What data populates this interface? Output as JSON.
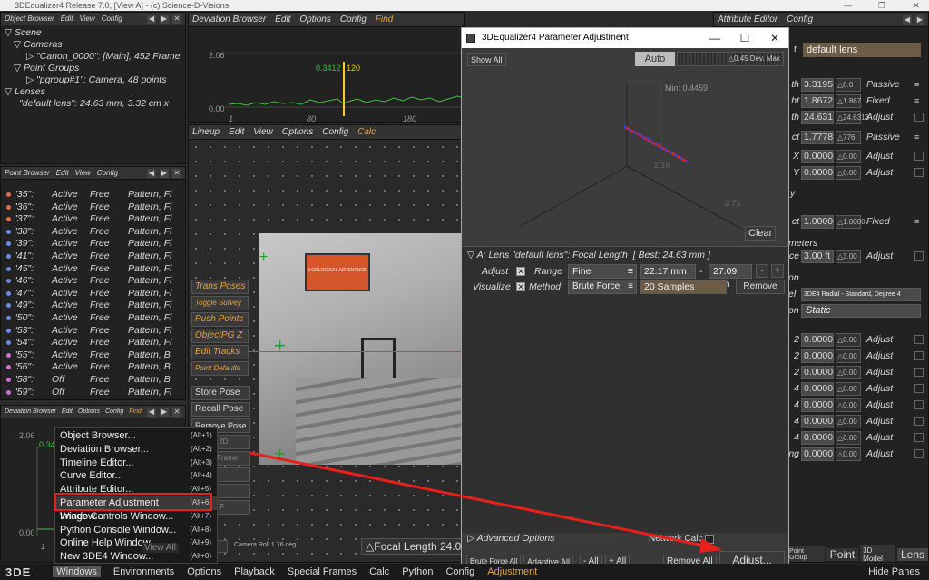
{
  "window": {
    "title": "3DEqualizer4 Release 7.0, [View A] - (c) Science-D-Visions"
  },
  "object_browser": {
    "menu": [
      "Object Browser",
      "Edit",
      "View",
      "Config"
    ],
    "tree": [
      {
        "label": "Scene",
        "level": 0
      },
      {
        "label": "Cameras",
        "level": 1
      },
      {
        "label": "\"Canon_0000\": [Main], 452 Frame",
        "level": 2,
        "highlight": true
      },
      {
        "label": "Point Groups",
        "level": 1
      },
      {
        "label": "\"pgroup#1\": Camera, 48 points",
        "level": 2,
        "highlight": true
      },
      {
        "label": "Lenses",
        "level": 0
      },
      {
        "label": "\"default lens\": 24.63 mm, 3.32 cm x",
        "level": 2
      }
    ]
  },
  "deviation_browser": {
    "menu": [
      "Deviation Browser",
      "Edit",
      "Options",
      "Config",
      "Find"
    ],
    "y_max": "2.06",
    "y_min": "0.00",
    "marker_value": "0.3412",
    "marker_frame": "120",
    "x_ticks": [
      "1",
      "80",
      "180"
    ]
  },
  "point_browser": {
    "menu": [
      "Point Browser",
      "Edit",
      "View",
      "Config"
    ],
    "rows": [
      {
        "name": "\"35\":",
        "status": "Active",
        "mode": "Free",
        "type": "Pattern, Fi",
        "color": "#e06c4c"
      },
      {
        "name": "\"36\":",
        "status": "Active",
        "mode": "Free",
        "type": "Pattern, Fi",
        "color": "#e06c4c"
      },
      {
        "name": "\"37\":",
        "status": "Active",
        "mode": "Free",
        "type": "Pattern, Fi",
        "color": "#e06c4c"
      },
      {
        "name": "\"38\":",
        "status": "Active",
        "mode": "Free",
        "type": "Pattern, Fi",
        "color": "#6c8ce0"
      },
      {
        "name": "\"39\":",
        "status": "Active",
        "mode": "Free",
        "type": "Pattern, Fi",
        "color": "#6c8ce0"
      },
      {
        "name": "\"41\":",
        "status": "Active",
        "mode": "Free",
        "type": "Pattern, Fi",
        "color": "#6c8ce0"
      },
      {
        "name": "\"45\":",
        "status": "Active",
        "mode": "Free",
        "type": "Pattern, Fi",
        "color": "#6c8ce0"
      },
      {
        "name": "\"46\":",
        "status": "Active",
        "mode": "Free",
        "type": "Pattern, Fi",
        "color": "#6c8ce0"
      },
      {
        "name": "\"47\":",
        "status": "Active",
        "mode": "Free",
        "type": "Pattern, Fi",
        "color": "#6c8ce0"
      },
      {
        "name": "\"49\":",
        "status": "Active",
        "mode": "Free",
        "type": "Pattern, Fi",
        "color": "#6c8ce0"
      },
      {
        "name": "\"50\":",
        "status": "Active",
        "mode": "Free",
        "type": "Pattern, Fi",
        "color": "#6c8ce0"
      },
      {
        "name": "\"53\":",
        "status": "Active",
        "mode": "Free",
        "type": "Pattern, Fi",
        "color": "#6c8ce0"
      },
      {
        "name": "\"54\":",
        "status": "Active",
        "mode": "Free",
        "type": "Pattern, Fi",
        "color": "#6c8ce0"
      },
      {
        "name": "\"55\":",
        "status": "Active",
        "mode": "Free",
        "type": "Pattern, B",
        "color": "#d070d0"
      },
      {
        "name": "\"56\":",
        "status": "Active",
        "mode": "Free",
        "type": "Pattern, B",
        "color": "#d070d0"
      },
      {
        "name": "\"58\":",
        "status": "Off",
        "mode": "Free",
        "type": "Pattern, B",
        "color": "#d070d0"
      },
      {
        "name": "\"59\":",
        "status": "Off",
        "mode": "Free",
        "type": "Pattern, Fi",
        "color": "#d070d0"
      }
    ]
  },
  "deviation_small": {
    "menu": [
      "Deviation Browser",
      "Edit",
      "Options",
      "Config",
      "Find"
    ],
    "y_max": "2.06",
    "y_mid": "0.34",
    "y_min": "0.00",
    "x_first": "1"
  },
  "lineup": {
    "menu": [
      "Lineup",
      "Edit",
      "View",
      "Options",
      "Config",
      "Calc"
    ],
    "side_buttons": [
      "Trans Poses",
      "Toggle Survey",
      "Push Points",
      "ObjectPG Z",
      "Edit Tracks",
      "Point Defaults"
    ],
    "pose_buttons": [
      "Store Pose",
      "Recall Pose",
      "Remove Pose"
    ],
    "ghost_buttons": [
      "Center 2D",
      "Match Frame",
      "Extract",
      "Extract",
      "Extract F"
    ],
    "focal_field": "1.76",
    "camera_roll": "Camera Roll 1.76 deg",
    "focal_length_label": "Focal Length 24.0",
    "view_all": "View All",
    "sign_text": "ECOLOGICAL ADVENTURE"
  },
  "context_menu": {
    "items": [
      {
        "label": "Object Browser...",
        "key": ""
      },
      {
        "label": "Deviation Browser...",
        "key": ""
      },
      {
        "label": "Timeline Editor...",
        "key": ""
      },
      {
        "label": "Curve Editor...",
        "key": ""
      },
      {
        "label": "Attribute Editor...",
        "key": "(Alt+5)"
      },
      {
        "label": "Parameter Adjustment Window...",
        "key": "(Alt+6)",
        "selected": true
      },
      {
        "label": "Image Controls Window...",
        "key": "(Alt+7)"
      },
      {
        "label": "Python Console Window...",
        "key": "(Alt+8)"
      },
      {
        "label": "Online Help Window...",
        "key": "(Alt+9)"
      },
      {
        "label": "New 3DE4 Window...",
        "key": "(Alt+0)"
      }
    ],
    "shortcut_hints": [
      "(Alt+1)",
      "(Alt+2)",
      "(Alt+3)",
      "(Alt+4)"
    ]
  },
  "param_dialog": {
    "title": "3DEqualizer4 Parameter Adjustment",
    "show_all": "Show All",
    "auto": "Auto",
    "dev_max": "0.45 Dev. Max",
    "min_label": "Min: 0.4459",
    "axis_labels": [
      "2.16",
      "2.71"
    ],
    "clear": "Clear",
    "section_title": "A: Lens \"default lens\": Focal Length",
    "best": "[ Best: 24.63 mm ]",
    "adjust_label": "Adjust",
    "range_label": "Range",
    "range_mode": "Fine",
    "range_min": "22.17 mm",
    "range_sep": "-",
    "range_max": "27.09 mm",
    "minus_btn": "-",
    "plus_btn": "+",
    "visualize_label": "Visualize",
    "method_label": "Method",
    "method_value": "Brute Force",
    "samples": "20 Samples",
    "remove": "Remove",
    "advanced": "Advanced Options",
    "network_calc": "Network Calc",
    "bottom_buttons": [
      "Brute Force All",
      "Adaptive All",
      "- All",
      "+ All"
    ],
    "remove_all": "Remove All",
    "adjust_btn": "Adjust..."
  },
  "attribute_editor": {
    "menu": [
      "Attribute Editor",
      "Config"
    ],
    "lens_name": "default lens",
    "rows": [
      {
        "label": "th",
        "value": "3.3195",
        "delta": "0.0",
        "mode": "Passive"
      },
      {
        "label": "ht",
        "value": "1.8672",
        "delta": "1.867",
        "mode": "Fixed"
      },
      {
        "label": "th",
        "value": "24.631",
        "delta": "24.6313",
        "mode": "Adjust"
      },
      {
        "label": "ct",
        "value": "1.7778",
        "delta": "776",
        "mode": "Passive"
      },
      {
        "label": "X",
        "value": "0.0000",
        "delta": "0.00",
        "mode": "Adjust"
      },
      {
        "label": "Y",
        "value": "0.0000",
        "delta": "0.00",
        "mode": "Adjust"
      },
      {
        "label": "ct",
        "value": "1.0000",
        "delta": "1.0000",
        "mode": "Fixed"
      },
      {
        "label": "ce",
        "value": "3.00 ft",
        "delta": "3.00",
        "mode": "Adjust"
      }
    ],
    "section_y": "y",
    "meters": "meters",
    "on": "on",
    "model_label": "el",
    "model_value": "3DE4 Radial - Standard, Degree 4",
    "static_label": "on",
    "static_value": "Static",
    "coeff_rows": [
      {
        "label": "2",
        "value": "0.0000",
        "mode": "Adjust"
      },
      {
        "label": "2",
        "value": "0.0000",
        "mode": "Adjust"
      },
      {
        "label": "2",
        "value": "0.0000",
        "mode": "Adjust"
      },
      {
        "label": "4",
        "value": "0.0000",
        "mode": "Adjust"
      },
      {
        "label": "4",
        "value": "0.0000",
        "mode": "Adjust"
      },
      {
        "label": "4",
        "value": "0.0000",
        "mode": "Adjust"
      },
      {
        "label": "4",
        "value": "0.0000",
        "mode": "Adjust"
      },
      {
        "label": "ng",
        "value": "0.0000",
        "mode": "Adjust"
      }
    ],
    "tabs": [
      "Point Group",
      "Point",
      "3D Model",
      "Lens"
    ]
  },
  "bottom_bar": {
    "logo": "3DE",
    "items": [
      "Windows",
      "Environments",
      "Options",
      "Playback",
      "Special Frames",
      "Calc",
      "Python",
      "Config",
      "Adjustment"
    ],
    "hide_panes": "Hide Panes"
  },
  "colors": {
    "accent": "#e8a23c",
    "red_arrow": "#e8201a",
    "graph_green": "#3fbf3f"
  }
}
